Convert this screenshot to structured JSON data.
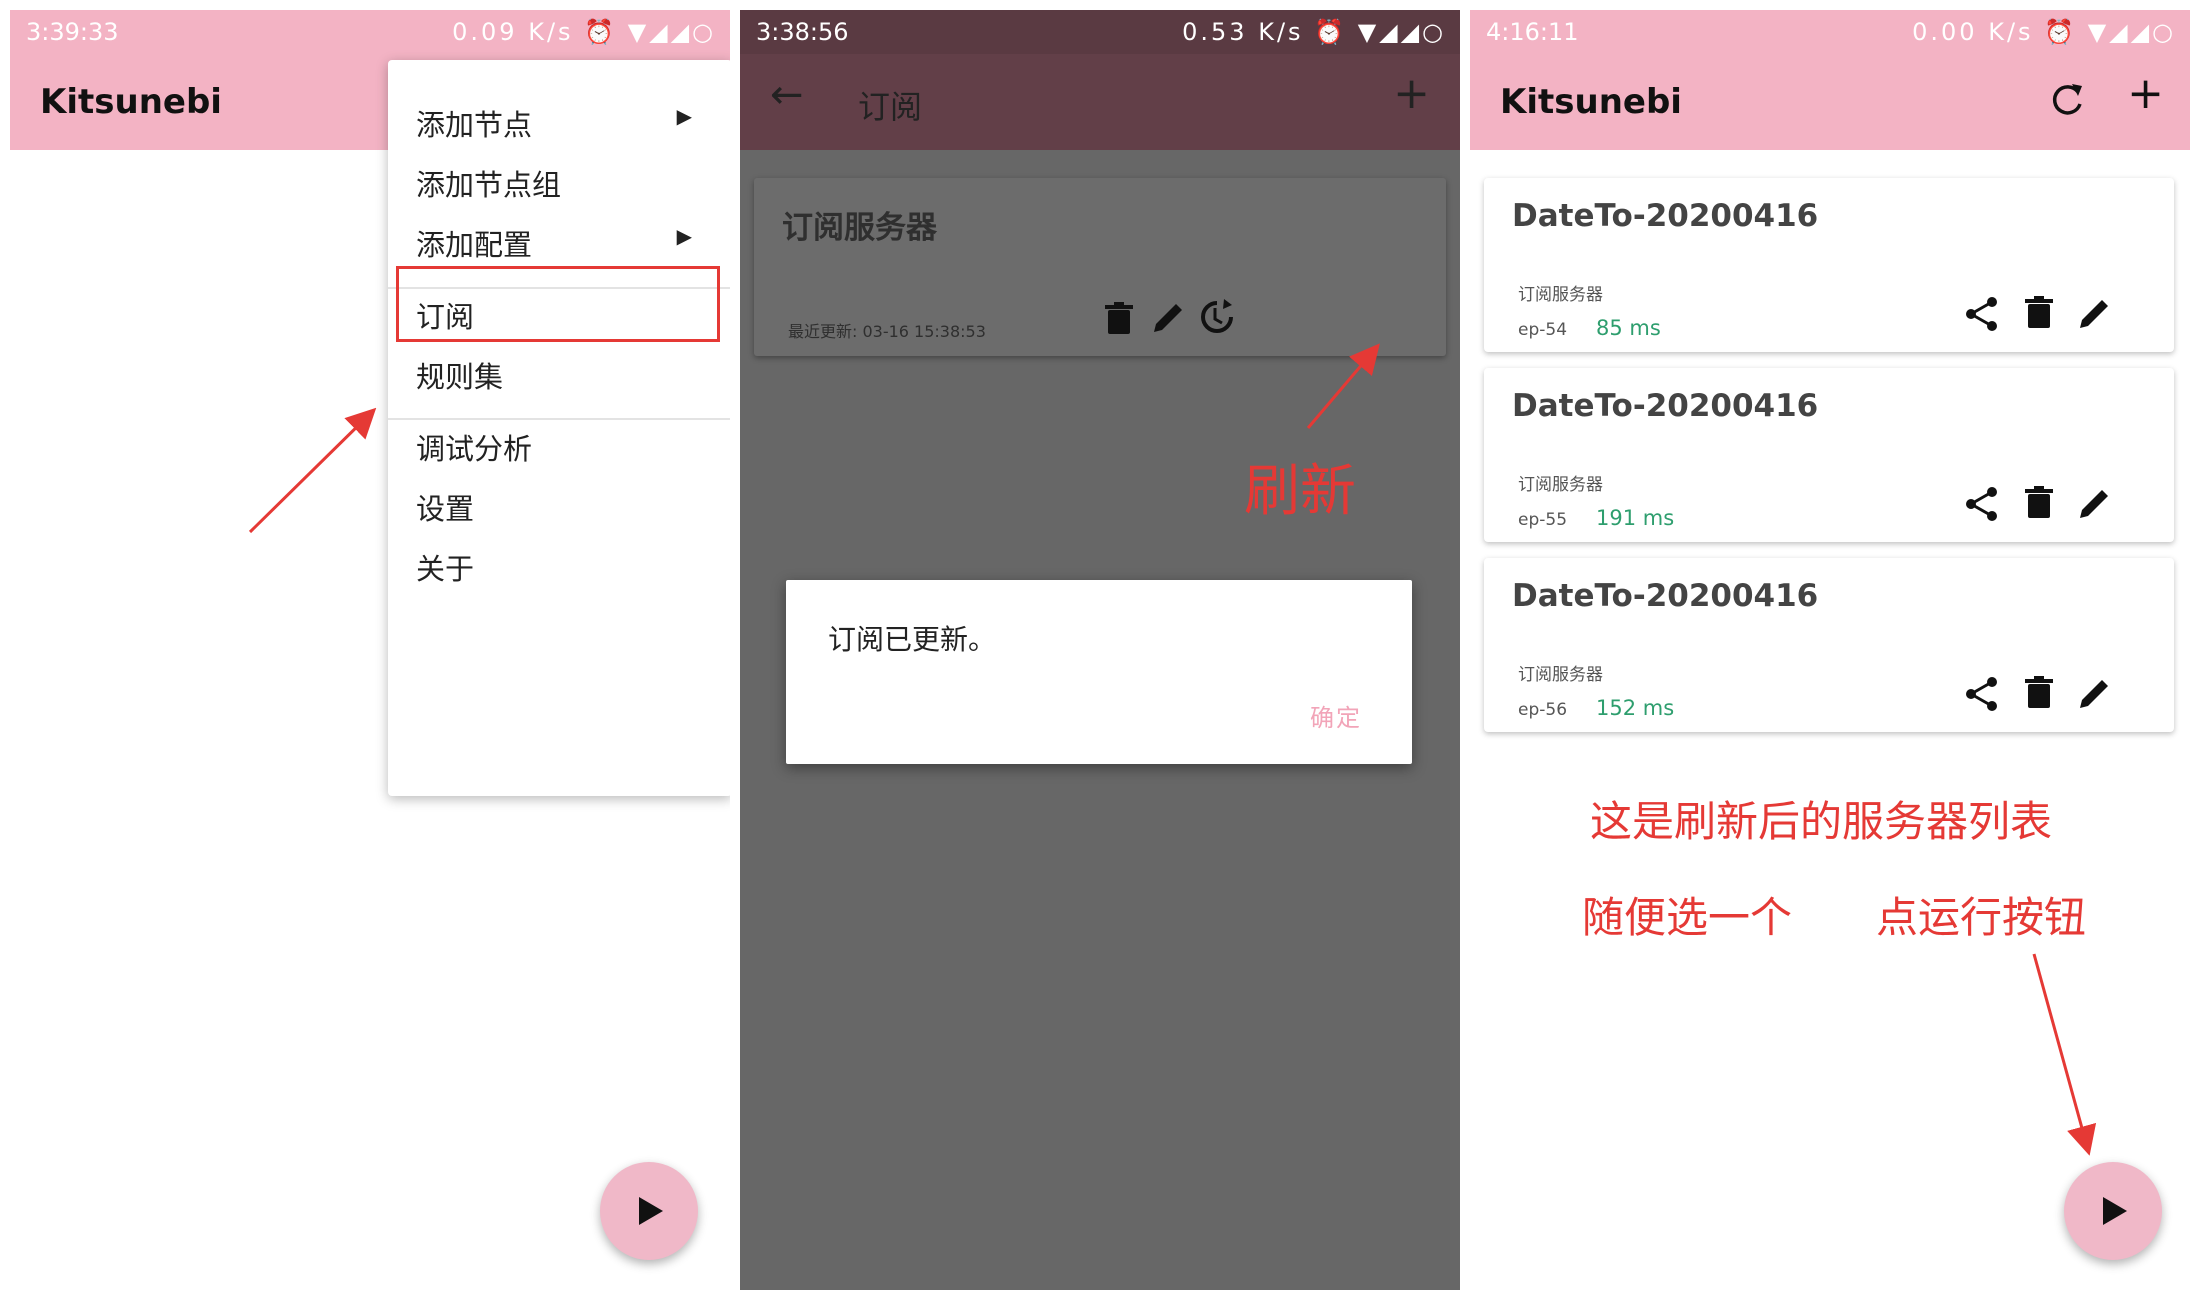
{
  "panel1": {
    "status": {
      "time": "3:39:33",
      "speed": "0.09 K/s"
    },
    "app_title": "Kitsunebi",
    "menu": {
      "add_node": "添加节点",
      "add_node_group": "添加节点组",
      "add_config": "添加配置",
      "subscription": "订阅",
      "rule_sets": "规则集",
      "debug": "调试分析",
      "settings": "设置",
      "about": "关于"
    }
  },
  "panel2": {
    "status": {
      "time": "3:38:56",
      "speed": "0.53 K/s"
    },
    "title": "订阅",
    "card": {
      "name": "订阅服务器",
      "last_updated": "最近更新: 03-16 15:38:53"
    },
    "dialog": {
      "message": "订阅已更新。",
      "ok": "确定"
    },
    "annotation": "刷新"
  },
  "panel3": {
    "status": {
      "time": "4:16:11",
      "speed": "0.00 K/s"
    },
    "app_title": "Kitsunebi",
    "servers": [
      {
        "name": "DateTo-20200416",
        "type": "订阅服务器",
        "ep": "ep-54",
        "latency": "85 ms"
      },
      {
        "name": "DateTo-20200416",
        "type": "订阅服务器",
        "ep": "ep-55",
        "latency": "191 ms"
      },
      {
        "name": "DateTo-20200416",
        "type": "订阅服务器",
        "ep": "ep-56",
        "latency": "152 ms"
      }
    ],
    "annotation_line1": "这是刷新后的服务器列表",
    "annotation_left": "随便选一个",
    "annotation_right": "点运行按钮"
  },
  "colors": {
    "app_bar_pink": "#f3b3c4",
    "dim_header": "#623f48",
    "annotation_red": "#e53935",
    "latency_green": "#2e9e6e"
  }
}
